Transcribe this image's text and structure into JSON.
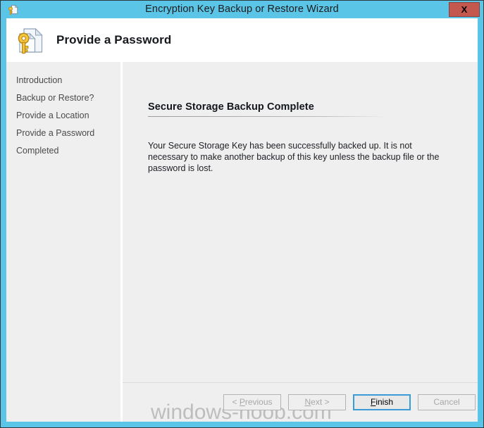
{
  "window": {
    "title": "Encryption Key Backup or Restore Wizard",
    "title_icon": "key-document-icon",
    "close_label": "X",
    "frame_color": "#5bc5e7",
    "close_color": "#c5584e"
  },
  "header": {
    "title": "Provide a Password",
    "icon": "key-document-icon"
  },
  "sidebar": {
    "items": [
      {
        "label": "Introduction"
      },
      {
        "label": "Backup or Restore?"
      },
      {
        "label": "Provide a Location"
      },
      {
        "label": "Provide a Password"
      },
      {
        "label": "Completed"
      }
    ]
  },
  "content": {
    "heading": "Secure Storage Backup Complete",
    "body": "Your Secure Storage Key has been successfully backed up.  It is not necessary to make another backup of this key unless the backup file or the password is lost."
  },
  "buttons": [
    {
      "label": "< Previous",
      "mnemonic": "P",
      "pre": "< ",
      "post": "revious",
      "state": "disabled"
    },
    {
      "label": "Next >",
      "mnemonic": "N",
      "pre": "",
      "post": "ext >",
      "state": "disabled"
    },
    {
      "label": "Finish",
      "mnemonic": "F",
      "pre": "",
      "post": "inish",
      "state": "default"
    },
    {
      "label": "Cancel",
      "mnemonic": "",
      "pre": "Cancel",
      "post": "",
      "state": "disabled"
    }
  ],
  "watermark": {
    "text": "windows-noob.com"
  }
}
